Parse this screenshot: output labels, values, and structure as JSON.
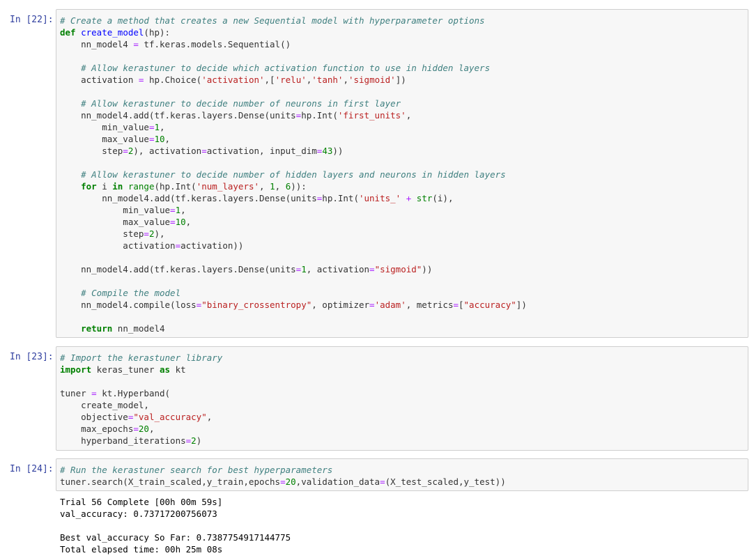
{
  "cells": [
    {
      "prompt": "In [22]:",
      "lines": [
        [
          [
            "c",
            "# Create a method that creates a new Sequential model with hyperparameter options"
          ]
        ],
        [
          [
            "k",
            "def"
          ],
          [
            "t",
            " "
          ],
          [
            "f",
            "create_model"
          ],
          [
            "t",
            "(hp):"
          ]
        ],
        [
          [
            "t",
            "    nn_model4 "
          ],
          [
            "o",
            "="
          ],
          [
            "t",
            " tf.keras.models.Sequential()"
          ]
        ],
        [],
        [
          [
            "t",
            "    "
          ],
          [
            "c",
            "# Allow kerastuner to decide which activation function to use in hidden layers"
          ]
        ],
        [
          [
            "t",
            "    activation "
          ],
          [
            "o",
            "="
          ],
          [
            "t",
            " hp.Choice("
          ],
          [
            "s",
            "'activation'"
          ],
          [
            "t",
            ",["
          ],
          [
            "s",
            "'relu'"
          ],
          [
            "t",
            ","
          ],
          [
            "s",
            "'tanh'"
          ],
          [
            "t",
            ","
          ],
          [
            "s",
            "'sigmoid'"
          ],
          [
            "t",
            "])"
          ]
        ],
        [],
        [
          [
            "t",
            "    "
          ],
          [
            "c",
            "# Allow kerastuner to decide number of neurons in first layer"
          ]
        ],
        [
          [
            "t",
            "    nn_model4.add(tf.keras.layers.Dense(units"
          ],
          [
            "o",
            "="
          ],
          [
            "t",
            "hp.Int("
          ],
          [
            "s",
            "'first_units'"
          ],
          [
            "t",
            ","
          ]
        ],
        [
          [
            "t",
            "        min_value"
          ],
          [
            "o",
            "="
          ],
          [
            "n",
            "1"
          ],
          [
            "t",
            ","
          ]
        ],
        [
          [
            "t",
            "        max_value"
          ],
          [
            "o",
            "="
          ],
          [
            "n",
            "10"
          ],
          [
            "t",
            ","
          ]
        ],
        [
          [
            "t",
            "        step"
          ],
          [
            "o",
            "="
          ],
          [
            "n",
            "2"
          ],
          [
            "t",
            "), activation"
          ],
          [
            "o",
            "="
          ],
          [
            "t",
            "activation, input_dim"
          ],
          [
            "o",
            "="
          ],
          [
            "n",
            "43"
          ],
          [
            "t",
            "))"
          ]
        ],
        [],
        [
          [
            "t",
            "    "
          ],
          [
            "c",
            "# Allow kerastuner to decide number of hidden layers and neurons in hidden layers"
          ]
        ],
        [
          [
            "t",
            "    "
          ],
          [
            "k",
            "for"
          ],
          [
            "t",
            " i "
          ],
          [
            "k",
            "in"
          ],
          [
            "t",
            " "
          ],
          [
            "b",
            "range"
          ],
          [
            "t",
            "(hp.Int("
          ],
          [
            "s",
            "'num_layers'"
          ],
          [
            "t",
            ", "
          ],
          [
            "n",
            "1"
          ],
          [
            "t",
            ", "
          ],
          [
            "n",
            "6"
          ],
          [
            "t",
            ")):"
          ]
        ],
        [
          [
            "t",
            "        nn_model4.add(tf.keras.layers.Dense(units"
          ],
          [
            "o",
            "="
          ],
          [
            "t",
            "hp.Int("
          ],
          [
            "s",
            "'units_'"
          ],
          [
            "t",
            " "
          ],
          [
            "o",
            "+"
          ],
          [
            "t",
            " "
          ],
          [
            "b",
            "str"
          ],
          [
            "t",
            "(i),"
          ]
        ],
        [
          [
            "t",
            "            min_value"
          ],
          [
            "o",
            "="
          ],
          [
            "n",
            "1"
          ],
          [
            "t",
            ","
          ]
        ],
        [
          [
            "t",
            "            max_value"
          ],
          [
            "o",
            "="
          ],
          [
            "n",
            "10"
          ],
          [
            "t",
            ","
          ]
        ],
        [
          [
            "t",
            "            step"
          ],
          [
            "o",
            "="
          ],
          [
            "n",
            "2"
          ],
          [
            "t",
            "),"
          ]
        ],
        [
          [
            "t",
            "            activation"
          ],
          [
            "o",
            "="
          ],
          [
            "t",
            "activation))"
          ]
        ],
        [],
        [
          [
            "t",
            "    nn_model4.add(tf.keras.layers.Dense(units"
          ],
          [
            "o",
            "="
          ],
          [
            "n",
            "1"
          ],
          [
            "t",
            ", activation"
          ],
          [
            "o",
            "="
          ],
          [
            "s",
            "\"sigmoid\""
          ],
          [
            "t",
            "))"
          ]
        ],
        [],
        [
          [
            "t",
            "    "
          ],
          [
            "c",
            "# Compile the model"
          ]
        ],
        [
          [
            "t",
            "    nn_model4.compile(loss"
          ],
          [
            "o",
            "="
          ],
          [
            "s",
            "\"binary_crossentropy\""
          ],
          [
            "t",
            ", optimizer"
          ],
          [
            "o",
            "="
          ],
          [
            "s",
            "'adam'"
          ],
          [
            "t",
            ", metrics"
          ],
          [
            "o",
            "="
          ],
          [
            "t",
            "["
          ],
          [
            "s",
            "\"accuracy\""
          ],
          [
            "t",
            "])"
          ]
        ],
        [],
        [
          [
            "t",
            "    "
          ],
          [
            "k",
            "return"
          ],
          [
            "t",
            " nn_model4"
          ]
        ]
      ],
      "output": []
    },
    {
      "prompt": "In [23]:",
      "lines": [
        [
          [
            "c",
            "# Import the kerastuner library"
          ]
        ],
        [
          [
            "k",
            "import"
          ],
          [
            "t",
            " keras_tuner "
          ],
          [
            "k",
            "as"
          ],
          [
            "t",
            " kt"
          ]
        ],
        [],
        [
          [
            "t",
            "tuner "
          ],
          [
            "o",
            "="
          ],
          [
            "t",
            " kt.Hyperband("
          ]
        ],
        [
          [
            "t",
            "    create_model,"
          ]
        ],
        [
          [
            "t",
            "    objective"
          ],
          [
            "o",
            "="
          ],
          [
            "s",
            "\"val_accuracy\""
          ],
          [
            "t",
            ","
          ]
        ],
        [
          [
            "t",
            "    max_epochs"
          ],
          [
            "o",
            "="
          ],
          [
            "n",
            "20"
          ],
          [
            "t",
            ","
          ]
        ],
        [
          [
            "t",
            "    hyperband_iterations"
          ],
          [
            "o",
            "="
          ],
          [
            "n",
            "2"
          ],
          [
            "t",
            ")"
          ]
        ]
      ],
      "output": []
    },
    {
      "prompt": "In [24]:",
      "lines": [
        [
          [
            "c",
            "# Run the kerastuner search for best hyperparameters"
          ]
        ],
        [
          [
            "t",
            "tuner.search(X_train_scaled,y_train,epochs"
          ],
          [
            "o",
            "="
          ],
          [
            "n",
            "20"
          ],
          [
            "t",
            ",validation_data"
          ],
          [
            "o",
            "="
          ],
          [
            "t",
            "(X_test_scaled,y_test))"
          ]
        ]
      ],
      "output": [
        "Trial 56 Complete [00h 00m 59s]",
        "val_accuracy: 0.73717200756073",
        "",
        "Best val_accuracy So Far: 0.7387754917144775",
        "Total elapsed time: 00h 25m 08s"
      ]
    }
  ]
}
